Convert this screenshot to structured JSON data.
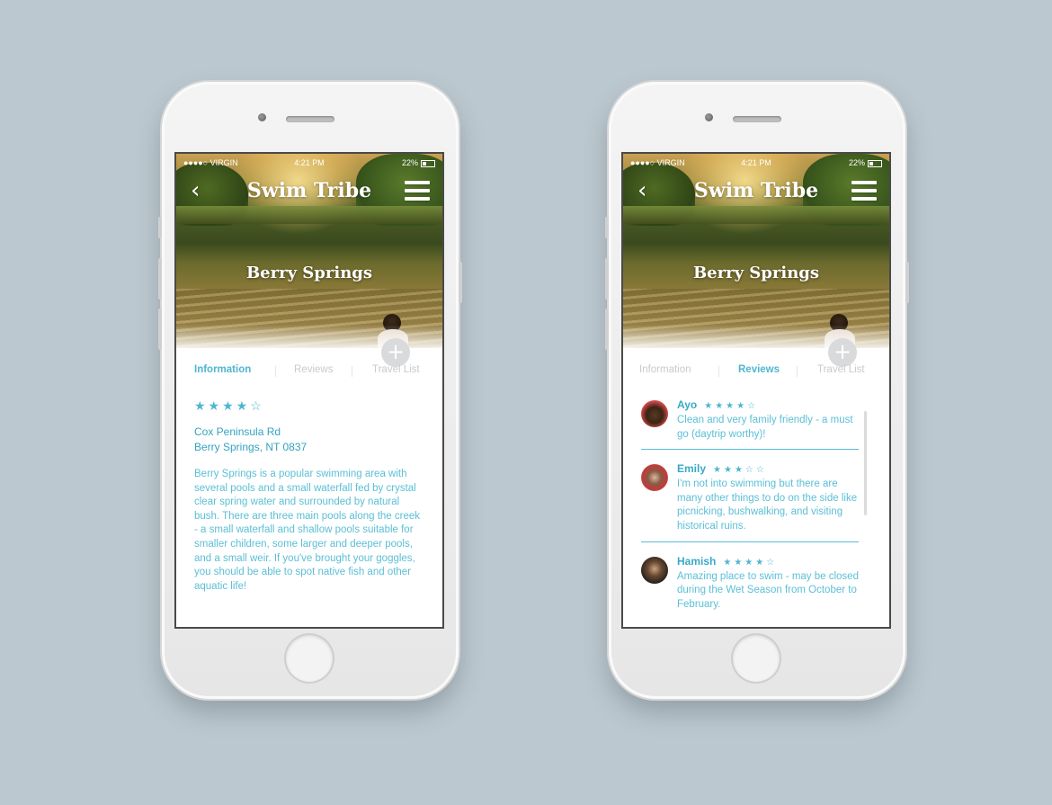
{
  "status_bar": {
    "carrier": "●●●●○ VIRGIN",
    "time": "4:21 PM",
    "battery": "22%"
  },
  "app": {
    "title": "Swim Tribe",
    "back_icon": "chevron-left-icon",
    "menu_icon": "hamburger-menu-icon",
    "add_icon": "plus-icon"
  },
  "place": {
    "name": "Berry Springs"
  },
  "tabs": [
    {
      "label": "Information"
    },
    {
      "label": "Reviews"
    },
    {
      "label": "Travel List"
    }
  ],
  "left_screen": {
    "active_tab": "Information",
    "rating_stars": "★★★★☆",
    "rating": 4,
    "address_line1": "Cox Peninsula Rd",
    "address_line2": "Berry Springs, NT 0837",
    "description": "Berry Springs is a popular swimming area with several pools and a small waterfall fed by crystal clear spring water and surrounded by natural bush. There are three main pools along the creek - a small waterfall and shallow pools suitable for smaller children, some larger and deeper pools, and a small weir. If you've brought your goggles, you should be able to spot native fish and other aquatic life!"
  },
  "right_screen": {
    "active_tab": "Reviews",
    "reviews": [
      {
        "name": "Ayo",
        "stars": "★★★★☆",
        "rating": 4,
        "text": "Clean and very family friendly - a must go (daytrip worthy)!"
      },
      {
        "name": "Emily",
        "stars": "★★★☆☆",
        "rating": 3,
        "text": "I'm not into swimming but there are many other things to do on the side like picnicking, bushwalking, and visiting historical ruins."
      },
      {
        "name": "Hamish",
        "stars": "★★★★☆",
        "rating": 4,
        "text": "Amazing place to swim - may be closed during the Wet Season from October to February."
      }
    ]
  },
  "colors": {
    "background": "#bcc8cf",
    "accent": "#4fb6d0",
    "tab_inactive": "#c8cacc"
  }
}
